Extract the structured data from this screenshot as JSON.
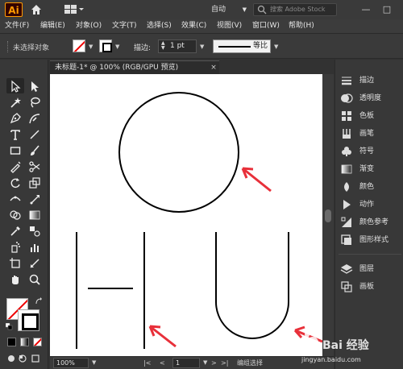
{
  "titlebar": {
    "app_logo": "Ai",
    "workspace_label": "自动",
    "stock_search_placeholder": "搜索 Adobe Stock",
    "minimize": "—",
    "maximize": "□"
  },
  "menubar": {
    "items": [
      "文件(F)",
      "编辑(E)",
      "对象(O)",
      "文字(T)",
      "选择(S)",
      "效果(C)",
      "视图(V)",
      "窗口(W)",
      "帮助(H)"
    ]
  },
  "control_bar": {
    "selection_status": "未选择对象",
    "stroke_label": "描边:",
    "stroke_weight": "1 pt",
    "profile_label": "等比"
  },
  "document": {
    "tab_title": "未标题-1* @ 100% (RGB/GPU 预览)",
    "close_glyph": "×"
  },
  "statusbar": {
    "zoom": "100%",
    "page": "1",
    "status_text": "编组选择",
    "nav_first": "|<",
    "nav_prev": "<",
    "nav_next": ">",
    "nav_last": ">|"
  },
  "panels": {
    "items": [
      {
        "label": "描边",
        "icon": "stroke-panel-icon"
      },
      {
        "label": "透明度",
        "icon": "transparency-icon"
      },
      {
        "label": "色板",
        "icon": "swatches-icon"
      },
      {
        "label": "画笔",
        "icon": "brushes-icon"
      },
      {
        "label": "符号",
        "icon": "symbols-icon"
      },
      {
        "label": "渐变",
        "icon": "gradient-icon"
      },
      {
        "label": "颜色",
        "icon": "color-icon"
      },
      {
        "label": "动作",
        "icon": "actions-icon"
      },
      {
        "label": "颜色参考",
        "icon": "color-guide-icon"
      },
      {
        "label": "图形样式",
        "icon": "graphic-styles-icon"
      },
      {
        "label": "图层",
        "icon": "layers-icon"
      },
      {
        "label": "画板",
        "icon": "artboards-icon"
      }
    ]
  },
  "watermark": {
    "brand": "Bai 经验",
    "url": "jingyan.baidu.com"
  },
  "colors": {
    "arrow_red": "#e8303a",
    "app_accent": "#ff9a00"
  }
}
